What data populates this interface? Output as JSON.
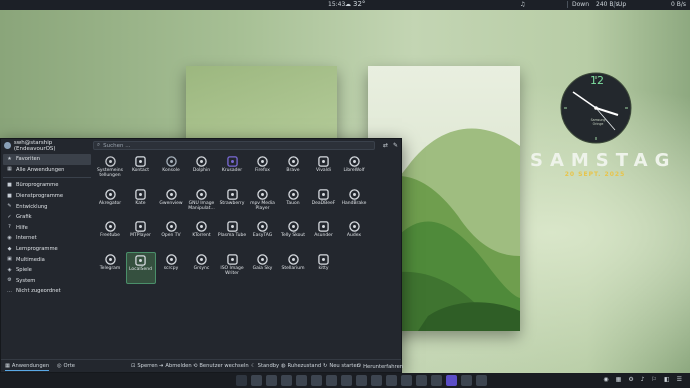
{
  "topbar": {
    "time": "15:43",
    "weather": "32°",
    "music_icon": "♫",
    "down_label": "Down",
    "down_value": "240 B/s",
    "up_label": "Up",
    "up_value": "0 B/s"
  },
  "clock": {
    "hour_label": "12",
    "brand_line1": "Samsung",
    "brand_line2": "Oringe"
  },
  "date": {
    "weekday": "SAMSTAG",
    "date": "20 SEPT. 2025"
  },
  "launcher": {
    "user": "swh@starship (EndeavourOS)",
    "search_placeholder": "Suchen ...",
    "sidebar": [
      {
        "label": "Favoriten",
        "icon": "★"
      },
      {
        "label": "Alle Anwendungen",
        "icon": "▦"
      },
      {
        "label": "Büroprogramme",
        "icon": "■"
      },
      {
        "label": "Dienstprogramme",
        "icon": "■"
      },
      {
        "label": "Entwicklung",
        "icon": "✎"
      },
      {
        "label": "Grafik",
        "icon": "✓"
      },
      {
        "label": "Hilfe",
        "icon": "?"
      },
      {
        "label": "Internet",
        "icon": "◉"
      },
      {
        "label": "Lernprogramme",
        "icon": "◆"
      },
      {
        "label": "Multimedia",
        "icon": "▣"
      },
      {
        "label": "Spiele",
        "icon": "◈"
      },
      {
        "label": "System",
        "icon": "⚙"
      },
      {
        "label": "Nicht zugeordnet",
        "icon": "…"
      }
    ],
    "apps": [
      {
        "label": "Systemeins tellungen",
        "color": "#c9ccd1",
        "icon": "settings-icon"
      },
      {
        "label": "Kontact",
        "color": "#d8dde3",
        "icon": "kontact-icon"
      },
      {
        "label": "Konsole",
        "color": "#a9b3bd",
        "icon": "terminal-icon"
      },
      {
        "label": "Dolphin",
        "color": "#d5d9de",
        "icon": "folder-icon"
      },
      {
        "label": "Krusader",
        "color": "#7a6ad6",
        "icon": "krusader-icon"
      },
      {
        "label": "Firefox",
        "color": "#d7dbe0",
        "icon": "firefox-icon"
      },
      {
        "label": "Brave",
        "color": "#d7dbe0",
        "icon": "brave-icon"
      },
      {
        "label": "Vivaldi",
        "color": "#d7dbe0",
        "icon": "vivaldi-icon"
      },
      {
        "label": "LibreWolf",
        "color": "#d7dbe0",
        "icon": "librewolf-icon"
      },
      {
        "label": "Akregator",
        "color": "#d7dbe0",
        "icon": "rss-icon"
      },
      {
        "label": "Kate",
        "color": "#d7dbe0",
        "icon": "kate-icon"
      },
      {
        "label": "Gwenview",
        "color": "#d7dbe0",
        "icon": "eye-icon"
      },
      {
        "label": "GNU Image Manipulat...",
        "color": "#d7dbe0",
        "icon": "gimp-icon"
      },
      {
        "label": "Strawberry",
        "color": "#d7dbe0",
        "icon": "strawberry-icon"
      },
      {
        "label": "mpv Media Player",
        "color": "#d7dbe0",
        "icon": "mpv-icon"
      },
      {
        "label": "Tauon",
        "color": "#d7dbe0",
        "icon": "tauon-icon"
      },
      {
        "label": "DeaDBeeF",
        "color": "#d7dbe0",
        "icon": "deadbeef-icon"
      },
      {
        "label": "HandBrake",
        "color": "#d7dbe0",
        "icon": "handbrake-icon"
      },
      {
        "label": "Freetube",
        "color": "#d7dbe0",
        "icon": "freetube-icon"
      },
      {
        "label": "MTPlayer",
        "color": "#d7dbe0",
        "icon": "mtplayer-icon"
      },
      {
        "label": "Open TV",
        "color": "#d7dbe0",
        "icon": "tv-icon"
      },
      {
        "label": "KTorrent",
        "color": "#d7dbe0",
        "icon": "torrent-icon"
      },
      {
        "label": "Plasma Tube",
        "color": "#d7dbe0",
        "icon": "plasmatube-icon"
      },
      {
        "label": "EasyTAG",
        "color": "#d7dbe0",
        "icon": "tag-icon"
      },
      {
        "label": "Telly Skout",
        "color": "#d7dbe0",
        "icon": "tellyskout-icon"
      },
      {
        "label": "Asunder",
        "color": "#d7dbe0",
        "icon": "asunder-icon"
      },
      {
        "label": "Audex",
        "color": "#d7dbe0",
        "icon": "audex-icon"
      },
      {
        "label": "Telegram",
        "color": "#d7dbe0",
        "icon": "telegram-icon"
      },
      {
        "label": "LocalSend",
        "color": "#d7dbe0",
        "icon": "localsend-icon"
      },
      {
        "label": "scrcpy",
        "color": "#d7dbe0",
        "icon": "scrcpy-icon"
      },
      {
        "label": "Grsync",
        "color": "#d7dbe0",
        "icon": "sync-icon"
      },
      {
        "label": "ISO Image Writer",
        "color": "#d7dbe0",
        "icon": "iso-icon"
      },
      {
        "label": "Gaia Sky",
        "color": "#d7dbe0",
        "icon": "gaiasky-icon"
      },
      {
        "label": "Stellarium",
        "color": "#d7dbe0",
        "icon": "stellarium-icon"
      },
      {
        "label": "kitty",
        "color": "#d7dbe0",
        "icon": "kitty-icon"
      }
    ],
    "active_app": "LocalSend",
    "footer": {
      "tab_apps": "Anwendungen",
      "tab_places": "Orte",
      "sleep": "Sperren",
      "logout": "Abmelden",
      "switch_user": "Benutzer wechseln",
      "standby": "Standby",
      "hibernate": "Ruhezustand",
      "restart": "Neu starten",
      "shutdown": "Herunterfahren"
    }
  },
  "taskbar": {
    "icons": [
      {
        "name": "apps-launcher-icon",
        "color": "#2f3640"
      },
      {
        "name": "dolphin-task-icon",
        "color": "#3d4550"
      },
      {
        "name": "firefox-task-icon",
        "color": "#3d4550"
      },
      {
        "name": "konsole-task-icon",
        "color": "#3d4550"
      },
      {
        "name": "brave-task-icon",
        "color": "#3d4550"
      },
      {
        "name": "vivaldi-task-icon",
        "color": "#3d4550"
      },
      {
        "name": "librewolf-task-icon",
        "color": "#3d4550"
      },
      {
        "name": "kate-task-icon",
        "color": "#3d4550"
      },
      {
        "name": "handbrake-task-icon",
        "color": "#3d4550"
      },
      {
        "name": "strawberry-task-icon",
        "color": "#3d4550"
      },
      {
        "name": "gimp-task-icon",
        "color": "#3d4550"
      },
      {
        "name": "settings-task-icon",
        "color": "#3d4550"
      },
      {
        "name": "telegram-task-icon",
        "color": "#3d4550"
      },
      {
        "name": "ktorrent-task-icon",
        "color": "#3d4550"
      },
      {
        "name": "krusader-task-icon",
        "color": "#5b4ec6"
      },
      {
        "name": "mpv-task-icon",
        "color": "#3d4550"
      },
      {
        "name": "system-monitor-task-icon",
        "color": "#3d4550"
      }
    ],
    "tray_icons": [
      "◉",
      "▦",
      "⚙",
      "♪",
      "⚐",
      "◧",
      "☰"
    ]
  }
}
